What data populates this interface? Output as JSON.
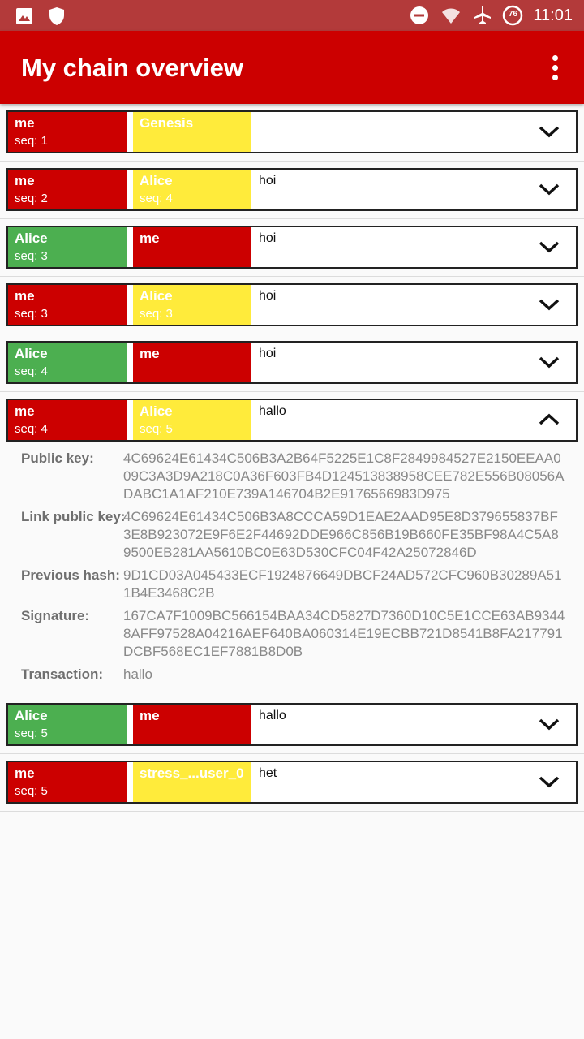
{
  "status_bar": {
    "time": "11:01",
    "battery": "76"
  },
  "app_bar": {
    "title": "My chain overview"
  },
  "blocks": [
    {
      "a_name": "me",
      "a_seq": "seq: 1",
      "a_color": "red",
      "b_name": "Genesis",
      "b_seq": "",
      "b_color": "yellow",
      "tx": "",
      "expanded": false
    },
    {
      "a_name": "me",
      "a_seq": "seq: 2",
      "a_color": "red",
      "b_name": "Alice",
      "b_seq": "seq: 4",
      "b_color": "yellow",
      "tx": "hoi",
      "expanded": false
    },
    {
      "a_name": "Alice",
      "a_seq": "seq: 3",
      "a_color": "green",
      "b_name": "me",
      "b_seq": "",
      "b_color": "red",
      "tx": "hoi",
      "expanded": false
    },
    {
      "a_name": "me",
      "a_seq": "seq: 3",
      "a_color": "red",
      "b_name": "Alice",
      "b_seq": "seq: 3",
      "b_color": "yellow",
      "tx": "hoi",
      "expanded": false
    },
    {
      "a_name": "Alice",
      "a_seq": "seq: 4",
      "a_color": "green",
      "b_name": "me",
      "b_seq": "",
      "b_color": "red",
      "tx": "hoi",
      "expanded": false
    },
    {
      "a_name": "me",
      "a_seq": "seq: 4",
      "a_color": "red",
      "b_name": "Alice",
      "b_seq": "seq: 5",
      "b_color": "yellow",
      "tx": "hallo",
      "expanded": true
    },
    {
      "a_name": "Alice",
      "a_seq": "seq: 5",
      "a_color": "green",
      "b_name": "me",
      "b_seq": "",
      "b_color": "red",
      "tx": "hallo",
      "expanded": false
    },
    {
      "a_name": "me",
      "a_seq": "seq: 5",
      "a_color": "red",
      "b_name": "stress_...user_0",
      "b_seq": "",
      "b_color": "yellow",
      "tx": "het",
      "expanded": false
    }
  ],
  "details": [
    {
      "label": "Public key:",
      "value": "4C69624E61434C506B3A2B64F5225E1C8F2849984527E2150EEAA009C3A3D9A218C0A36F603FB4D124513838958CEE782E556B08056ADABC1A1AF210E739A146704B2E9176566983D975"
    },
    {
      "label": "Link public key:",
      "value": "4C69624E61434C506B3A8CCCA59D1EAE2AAD95E8D379655837BF3E8B923072E9F6E2F44692DDE966C856B19B660FE35BF98A4C5A89500EB281AA5610BC0E63D530CFC04F42A25072846D"
    },
    {
      "label": "Previous hash:",
      "value": "9D1CD03A045433ECF1924876649DBCF24AD572CFC960B30289A511B4E3468C2B"
    },
    {
      "label": "Signature:",
      "value": "167CA7F1009BC566154BAA34CD5827D7360D10C5E1CCE63AB93448AFF97528A04216AEF640BA060314E19ECBB721D8541B8FA217791DCBF568EC1EF7881B8D0B"
    },
    {
      "label": "Transaction:",
      "value": "hallo"
    }
  ],
  "icons": {
    "status_left": [
      "image-icon",
      "shield-icon"
    ],
    "status_right": [
      "dnd-icon",
      "wifi-icon",
      "airplane-icon",
      "battery-icon"
    ],
    "menu": "more-vert-icon",
    "expand": "chevron-down-icon",
    "collapse": "chevron-up-icon"
  },
  "colors": {
    "red": "#cc0000",
    "green": "#4caf50",
    "yellow": "#ffeb3b",
    "appbar": "#cc0000",
    "statusbar": "#b33a3a"
  }
}
